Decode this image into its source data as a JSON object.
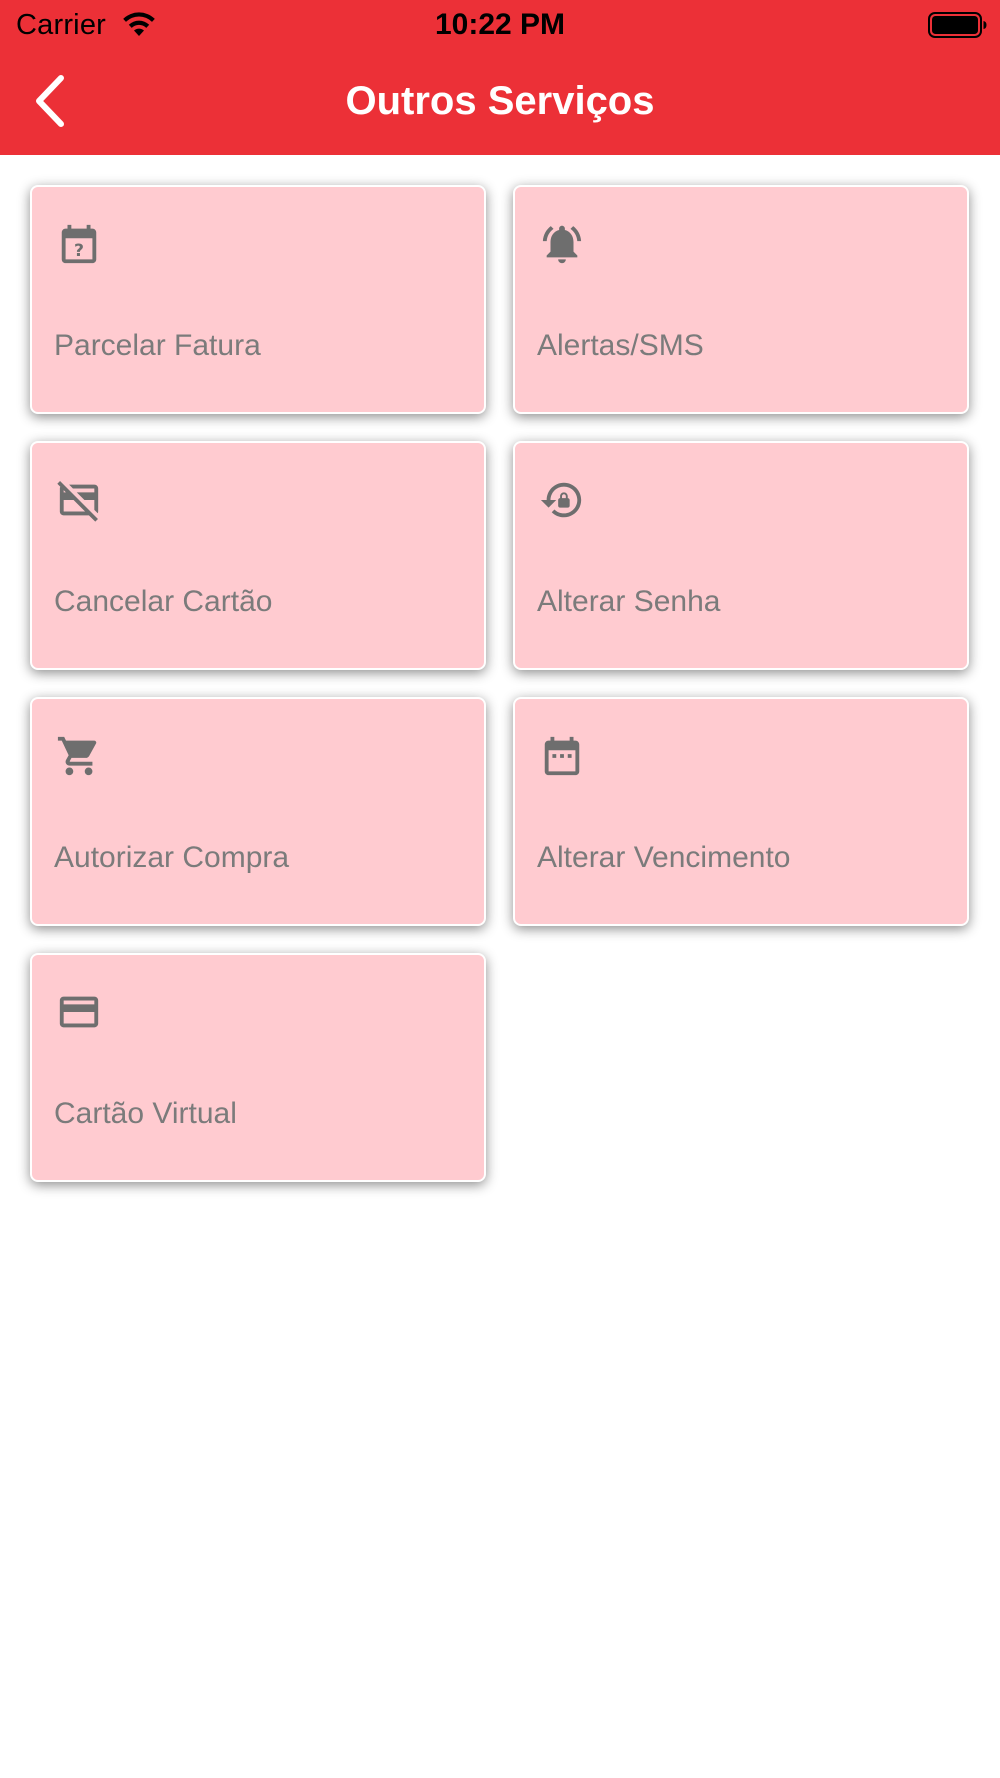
{
  "status_bar": {
    "carrier": "Carrier",
    "time": "10:22 PM",
    "wifi_icon": "wifi-icon",
    "battery_icon": "battery-full-icon"
  },
  "header": {
    "title": "Outros Serviços",
    "back_icon": "chevron-left-icon",
    "background_color": "#ec3037",
    "text_color": "#ffffff"
  },
  "services": [
    {
      "label": "Parcelar Fatura",
      "icon": "calendar-question-icon"
    },
    {
      "label": "Alertas/SMS",
      "icon": "bell-ringing-icon"
    },
    {
      "label": "Cancelar Cartão",
      "icon": "credit-card-off-icon"
    },
    {
      "label": "Alterar Senha",
      "icon": "lock-reset-icon"
    },
    {
      "label": "Autorizar Compra",
      "icon": "shopping-cart-icon"
    },
    {
      "label": "Alterar Vencimento",
      "icon": "calendar-icon"
    },
    {
      "label": "Cartão Virtual",
      "icon": "credit-card-icon"
    }
  ],
  "colors": {
    "tile_background": "#ffcbd0",
    "tile_text": "#7b7b7b",
    "icon": "#6e6e6e"
  }
}
